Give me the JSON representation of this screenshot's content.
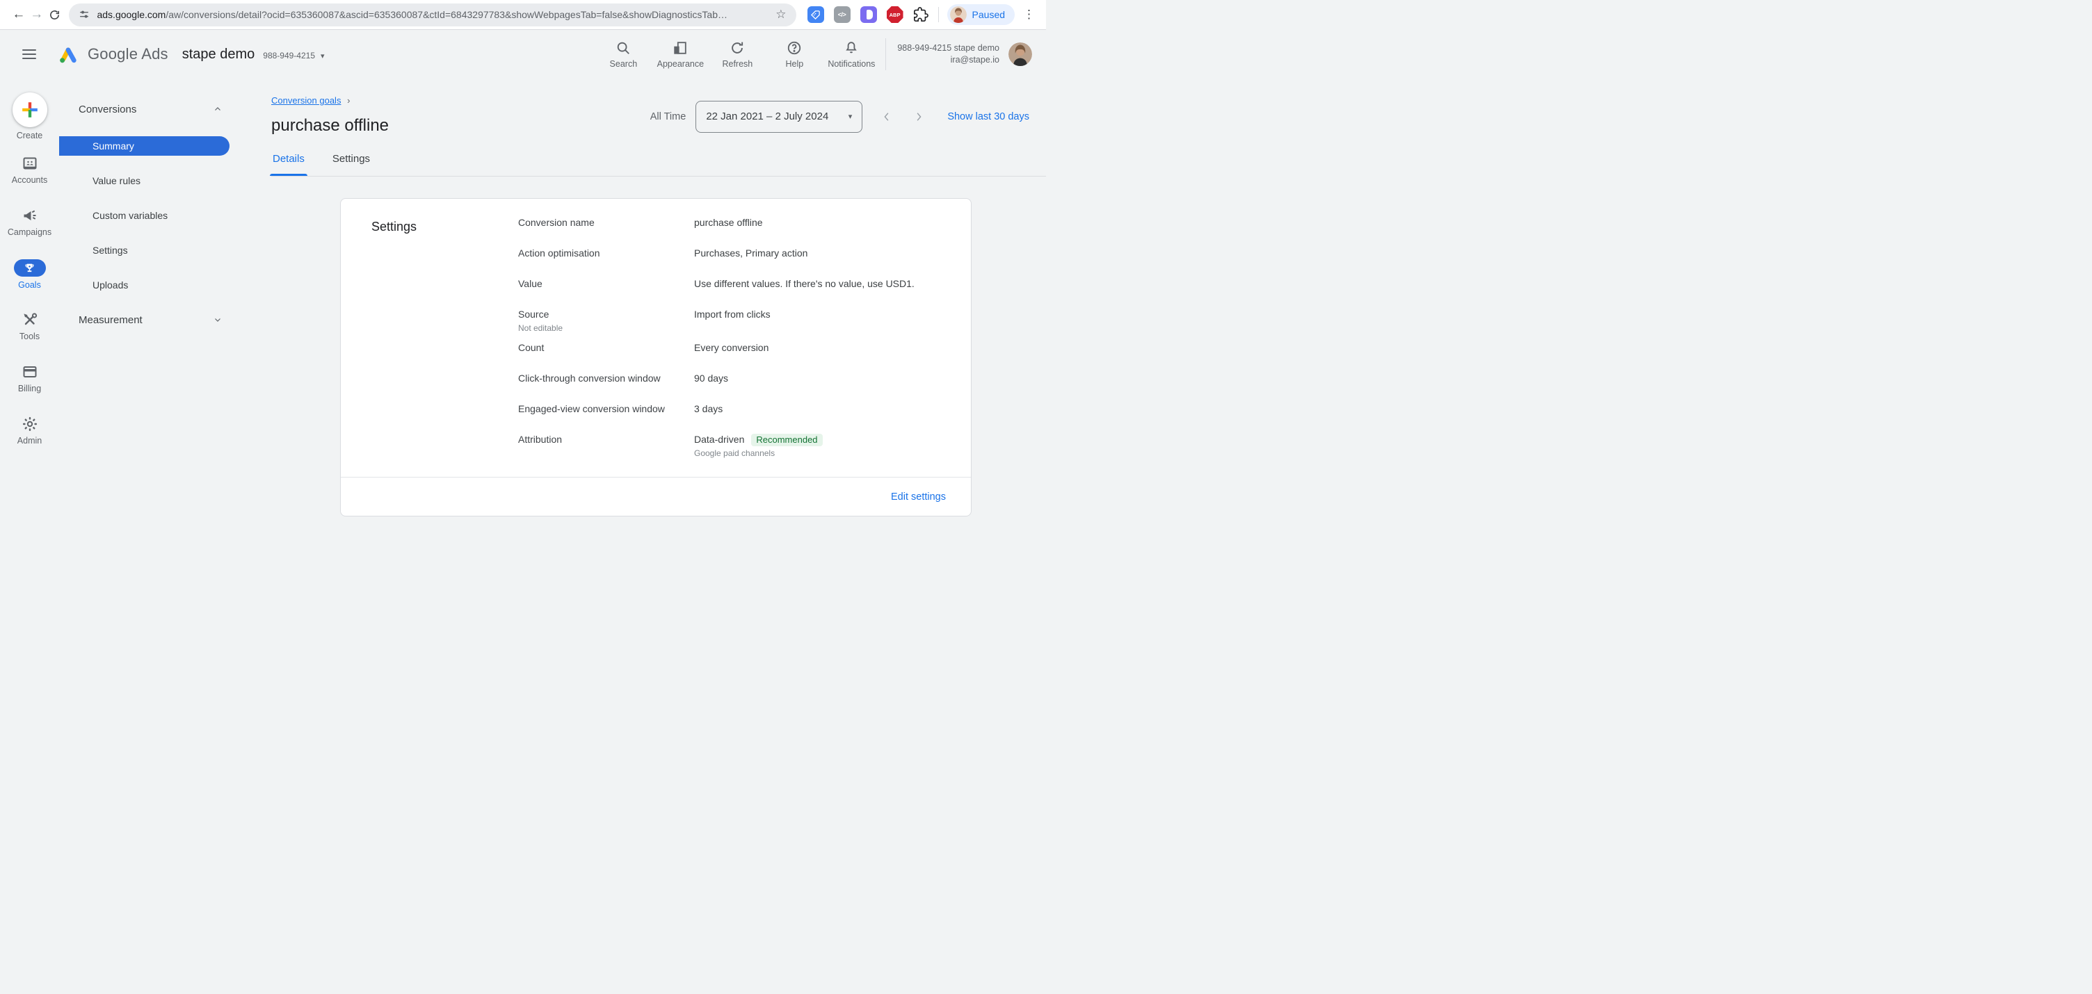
{
  "colors": {
    "accent": "#1a73e8",
    "nav_pill": "#2b6bd8",
    "badge_green": "#137333",
    "badge_bg": "#e6f4ea",
    "annotation_orange": "#f09b3c",
    "page_bg": "#f1f3f4"
  },
  "browser": {
    "url_domain": "ads.google.com",
    "url_path_pre": "/aw/conversions/detail?ocid=635360087&ascid=635360087",
    "url_highlight": "&ctId=6843297783",
    "url_path_post": "&showWebpagesTab=false&showDiagnosticsTab…",
    "bookmark_star": "☆",
    "back_arrow": "←",
    "forward_arrow": "→",
    "ext_code_label": "</>",
    "ext_abp_label": "ABP",
    "profile_status": "Paused",
    "kebab": "⋮"
  },
  "ads_header": {
    "product": "Google Ads",
    "account_name": "stape demo",
    "account_id": "988-949-4215",
    "caret": "▾",
    "actions": [
      {
        "label": "Search"
      },
      {
        "label": "Appearance"
      },
      {
        "label": "Refresh"
      },
      {
        "label": "Help"
      },
      {
        "label": "Notifications"
      }
    ],
    "account_line1": "988-949-4215 stape demo",
    "account_line2": "ira@stape.io"
  },
  "rail": {
    "items": [
      {
        "label": "Create"
      },
      {
        "label": "Accounts"
      },
      {
        "label": "Campaigns"
      },
      {
        "label": "Goals"
      },
      {
        "label": "Tools"
      },
      {
        "label": "Billing"
      },
      {
        "label": "Admin"
      }
    ]
  },
  "subnav": {
    "section1": "Conversions",
    "items": [
      {
        "label": "Summary"
      },
      {
        "label": "Value rules"
      },
      {
        "label": "Custom variables"
      },
      {
        "label": "Settings"
      },
      {
        "label": "Uploads"
      }
    ],
    "section2": "Measurement"
  },
  "content": {
    "breadcrumb": "Conversion goals",
    "breadcrumb_sep": "›",
    "title": "purchase offline",
    "tabs": [
      {
        "label": "Details"
      },
      {
        "label": "Settings"
      }
    ],
    "date": {
      "preset": "All Time",
      "range": "22 Jan 2021 – 2 July 2024",
      "caret": "▾",
      "quick_link": "Show last 30 days"
    }
  },
  "card": {
    "heading": "Settings",
    "rows": [
      {
        "label": "Conversion name",
        "value": "purchase offline"
      },
      {
        "label": "Action optimisation",
        "value": "Purchases, Primary action"
      },
      {
        "label": "Value",
        "value": "Use different values. If there's no value, use USD1."
      },
      {
        "label": "Source",
        "sublabel": "Not editable",
        "value": "Import from clicks"
      },
      {
        "label": "Count",
        "value": "Every conversion"
      },
      {
        "label": "Click-through conversion window",
        "value": "90 days"
      },
      {
        "label": "Engaged-view conversion window",
        "value": "3 days"
      },
      {
        "label": "Attribution",
        "value": "Data-driven",
        "badge": "Recommended",
        "value_sub": "Google paid channels"
      }
    ],
    "footer_link": "Edit settings"
  }
}
